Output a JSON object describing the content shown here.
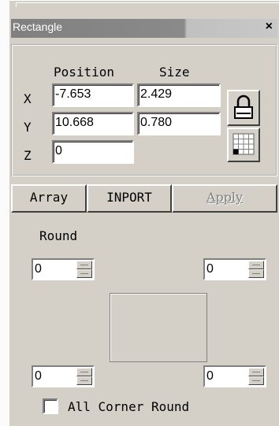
{
  "window": {
    "title": "Rectangle",
    "close_label": "×"
  },
  "coords": {
    "position_header": "Position",
    "size_header": "Size",
    "x_label": "X",
    "y_label": "Y",
    "z_label": "Z",
    "x_position": "-7.653",
    "x_size": "2.429",
    "y_position": "10.668",
    "y_size": "0.780",
    "z_position": "0"
  },
  "icons": {
    "lock": "padlock-icon",
    "grid": "anchor-grid-icon"
  },
  "buttons": {
    "array": "Array",
    "import": "INPORT",
    "apply": "Apply"
  },
  "round": {
    "label": "Round",
    "top_left": "0",
    "top_right": "0",
    "bottom_left": "0",
    "bottom_right": "0"
  },
  "all_corner": {
    "label": "All Corner Round",
    "checked": false
  }
}
